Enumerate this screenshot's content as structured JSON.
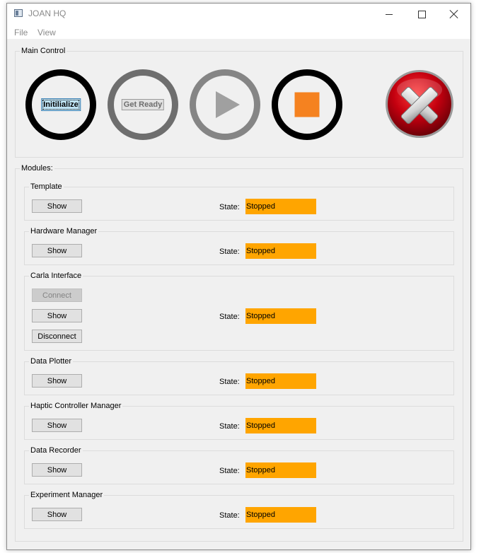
{
  "window": {
    "title": "JOAN HQ"
  },
  "menu": {
    "items": [
      "File",
      "View"
    ]
  },
  "main_control": {
    "title": "Main Control",
    "initialize_label": "Initilialize",
    "get_ready_label": "Get Ready"
  },
  "modules": {
    "title": "Modules:",
    "state_label": "State:",
    "template": {
      "title": "Template",
      "show": "Show",
      "state": "Stopped"
    },
    "hardware_manager": {
      "title": "Hardware Manager",
      "show": "Show",
      "state": "Stopped"
    },
    "carla_interface": {
      "title": "Carla Interface",
      "connect": "Connect",
      "show": "Show",
      "disconnect": "Disconnect",
      "state": "Stopped"
    },
    "data_plotter": {
      "title": "Data Plotter",
      "show": "Show",
      "state": "Stopped"
    },
    "haptic_controller_manager": {
      "title": "Haptic Controller Manager",
      "show": "Show",
      "state": "Stopped"
    },
    "data_recorder": {
      "title": "Data Recorder",
      "show": "Show",
      "state": "Stopped"
    },
    "experiment_manager": {
      "title": "Experiment Manager",
      "show": "Show",
      "state": "Stopped"
    }
  },
  "colors": {
    "state_stopped": "#ffa500",
    "stop_square": "#f58220",
    "exit_red": "#c4000f"
  },
  "icons": {
    "app": "app-window-icon",
    "play": "play-icon",
    "stop": "stop-icon",
    "exit": "exit-x-icon"
  }
}
